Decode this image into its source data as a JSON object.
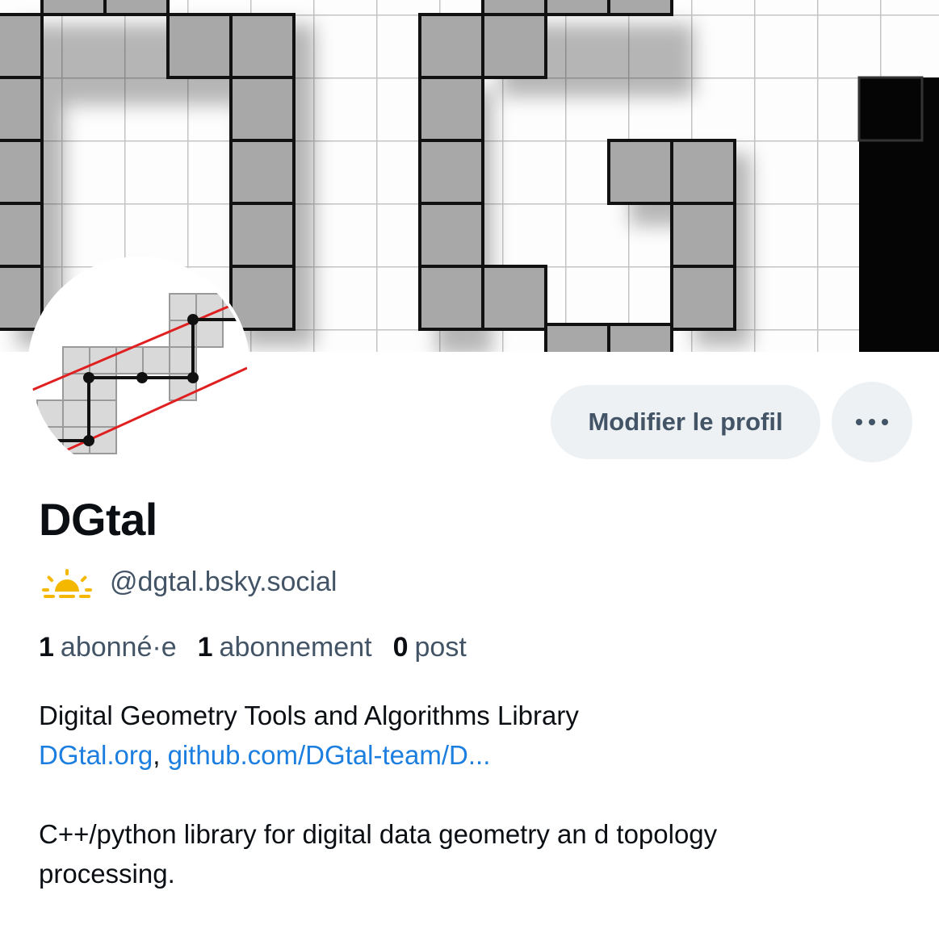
{
  "profile": {
    "display_name": "DGtal",
    "handle": "@dgtal.bsky.social",
    "badge_icon": "sunrise-icon",
    "edit_button_label": "Modifier le profil",
    "more_icon": "ellipsis-icon"
  },
  "stats": {
    "followers_count": "1",
    "followers_label": "abonné·e",
    "following_count": "1",
    "following_label": "abonnement",
    "posts_count": "0",
    "posts_label": "post"
  },
  "bio": {
    "line1": "Digital Geometry Tools and Algorithms Library",
    "link1": "DGtal.org",
    "separator": ", ",
    "link2": "github.com/DGtal-team/D...",
    "line3": "C++/python library for digital data geometry an d topology",
    "line4": "processing."
  },
  "colors": {
    "accent_link": "#1c7fe0",
    "muted_text": "#425466",
    "button_bg": "#eef1f4",
    "badge_yellow": "#f5b800"
  }
}
